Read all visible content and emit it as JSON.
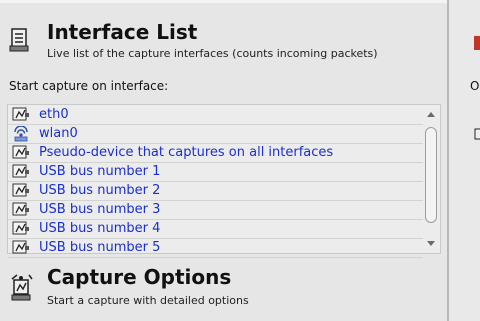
{
  "interface_list": {
    "title": "Interface List",
    "description": "Live list of the capture interfaces (counts incoming packets)",
    "start_label": "Start capture on interface:",
    "interfaces": [
      {
        "label": "eth0",
        "icon": "network-card-icon"
      },
      {
        "label": "wlan0",
        "icon": "wireless-icon"
      },
      {
        "label": "Pseudo-device that captures on all interfaces",
        "icon": "network-card-icon"
      },
      {
        "label": "USB bus number 1",
        "icon": "network-card-icon"
      },
      {
        "label": "USB bus number 2",
        "icon": "network-card-icon"
      },
      {
        "label": "USB bus number 3",
        "icon": "network-card-icon"
      },
      {
        "label": "USB bus number 4",
        "icon": "network-card-icon"
      },
      {
        "label": "USB bus number 5",
        "icon": "network-card-icon"
      }
    ]
  },
  "capture_options": {
    "title": "Capture Options",
    "description": "Start a capture with detailed options"
  },
  "right_panel": {
    "partial_letter": "O"
  },
  "colors": {
    "link": "#1a2fd0",
    "background": "#e6e6e6",
    "accent_red": "#c53226"
  }
}
